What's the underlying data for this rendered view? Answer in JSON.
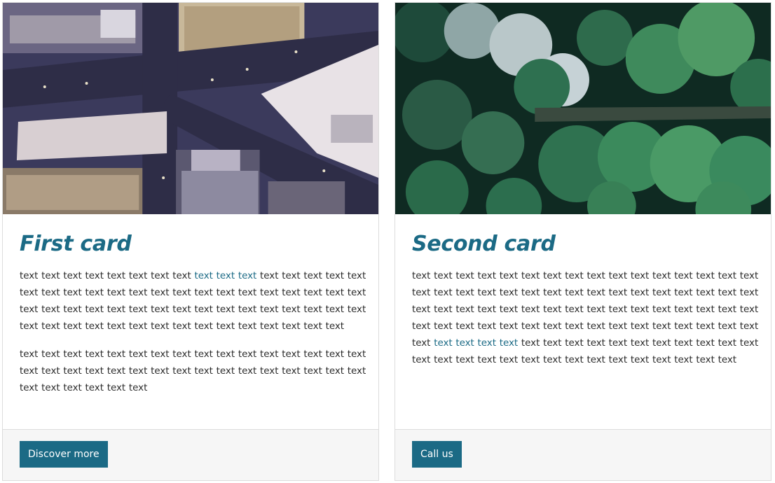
{
  "cards": [
    {
      "title": "First card",
      "paragraphs": [
        {
          "before": "text text text text text text text text ",
          "link": "text text text",
          "after": " text text text text text text text text text text text text text text text text text text text text text text text text text text text text text text text text text text text text text text text text text text text text text text text text text text text text"
        },
        {
          "before": "text text text text text text text text text text text text text text text text text text text text text text text text text text text text text text text text text text text text text text",
          "link": "",
          "after": ""
        }
      ],
      "image_alt": "aerial view of city intersection",
      "button_label": "Discover more"
    },
    {
      "title": "Second card",
      "paragraphs": [
        {
          "before": "text text text text text text text text text text text text text text text text text text text text text text text text text text text text text text text text text text text text text text text text text text text text text text text text text text text text text text text text text text text text text text text text text ",
          "link": "text text text text",
          "after": " text text text text text text text text text text text text text text text text text text text text text text text text text text"
        }
      ],
      "image_alt": "aerial view of forest with road",
      "button_label": "Call us"
    }
  ],
  "colors": {
    "accent": "#1b6a85",
    "footer_bg": "#f6f6f6",
    "border": "#dcdcdc",
    "text": "#2b2b2b"
  }
}
